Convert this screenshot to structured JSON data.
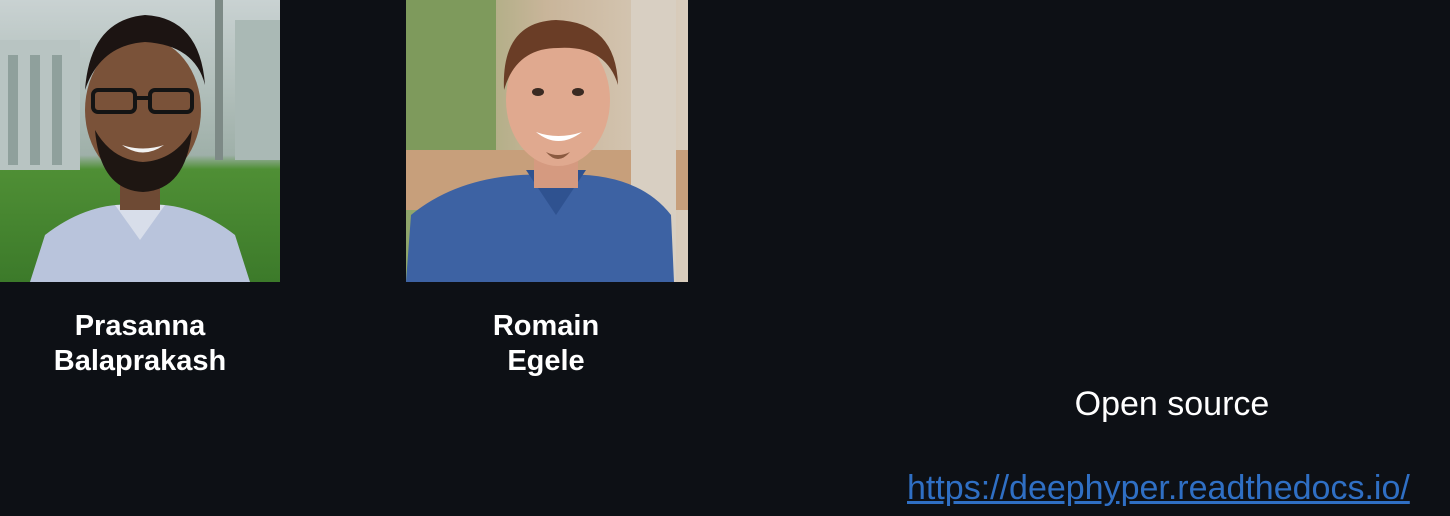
{
  "people": [
    {
      "first_name": "Prasanna",
      "last_name": "Balaprakash"
    },
    {
      "first_name": "Romain",
      "last_name": "Egele"
    }
  ],
  "footer": {
    "tagline": "Open source",
    "docs_link": "https://deephyper.readthedocs.io/"
  },
  "colors": {
    "background": "#0d1015",
    "text": "#ffffff",
    "link": "#2f6fc4"
  }
}
